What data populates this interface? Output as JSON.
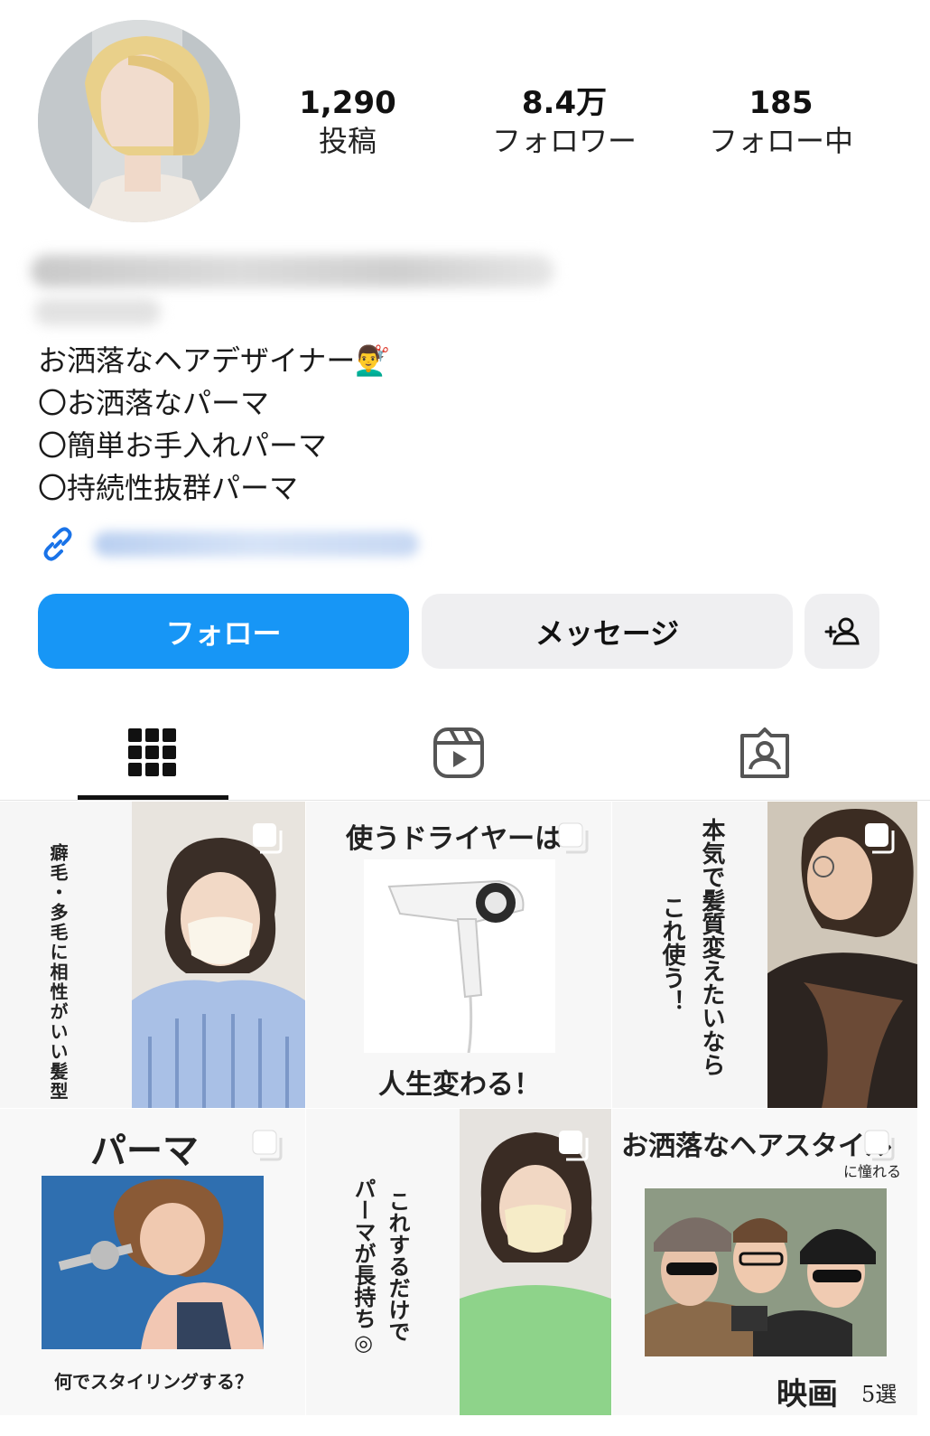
{
  "profile": {
    "stats": [
      {
        "value": "1,290",
        "label": "投稿"
      },
      {
        "value": "8.4万",
        "label": "フォロワー"
      },
      {
        "value": "185",
        "label": "フォロー中"
      }
    ],
    "bio": [
      "お洒落なヘアデザイナー💇‍♂️",
      "〇お洒落なパーマ",
      "〇簡単お手入れパーマ",
      "〇持続性抜群パーマ"
    ]
  },
  "actions": {
    "follow_label": "フォロー",
    "message_label": "メッセージ"
  },
  "tabs": [
    "grid-icon",
    "reels-icon",
    "tagged-icon"
  ],
  "posts": [
    {
      "vertical_text": "癖毛・多毛に相性がいい髪型"
    },
    {
      "title": "使うドライヤーは",
      "caption": "人生変わる！"
    },
    {
      "vertical_line1": "本気で髪質変えたいなら",
      "vertical_line2": "これ使う！"
    },
    {
      "title": "パーマ",
      "caption": "何でスタイリングする？"
    },
    {
      "vertical_line1": "これするだけで",
      "vertical_line2": "パーマが長持ち◎"
    },
    {
      "title": "お洒落なヘアスタイル",
      "subtitle": "に憧れる",
      "caption_big": "映画",
      "caption_small": "5選"
    }
  ],
  "colors": {
    "accent": "#1796f6",
    "button_gray": "#efeff1"
  }
}
